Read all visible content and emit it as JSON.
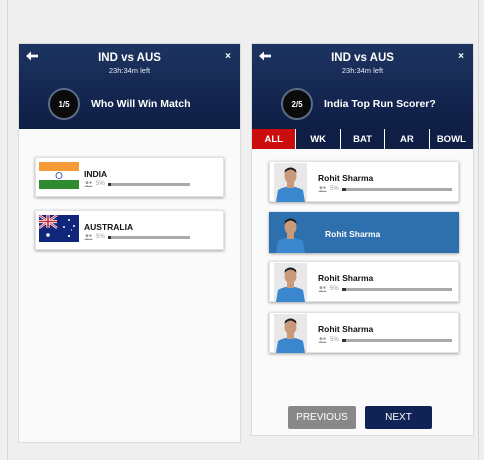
{
  "colors": {
    "header_bg": "#0e1e45",
    "active_tab": "#cc0d0d",
    "selected_card": "#2e6fae",
    "next_button": "#0f2454",
    "previous_button": "#888888"
  },
  "left_panel": {
    "match_title": "IND vs AUS",
    "time_left": "23h:34m left",
    "question_number": "1/5",
    "question": "Who Will Win Match",
    "teams": [
      {
        "name": "INDIA",
        "percent": "5%",
        "vote_fraction": 0.04,
        "flag": "india-flag"
      },
      {
        "name": "AUSTRALIA",
        "percent": "5%",
        "vote_fraction": 0.04,
        "flag": "australia-flag"
      }
    ]
  },
  "right_panel": {
    "match_title": "IND vs AUS",
    "time_left": "23h:34m left",
    "question_number": "2/5",
    "question": "India Top Run Scorer?",
    "tabs": [
      "ALL",
      "WK",
      "BAT",
      "AR",
      "BOWL"
    ],
    "active_tab": "ALL",
    "players": [
      {
        "name": "Rohit Sharma",
        "percent": "5%",
        "vote_fraction": 0.04,
        "selected": false
      },
      {
        "name": "Rohit Sharma",
        "percent": "",
        "vote_fraction": 0,
        "selected": true
      },
      {
        "name": "Rohit Sharma",
        "percent": "5%",
        "vote_fraction": 0.04,
        "selected": false
      },
      {
        "name": "Rohit Sharma",
        "percent": "5%",
        "vote_fraction": 0.04,
        "selected": false
      }
    ],
    "previous_label": "PREVIOUS",
    "next_label": "NEXT"
  }
}
